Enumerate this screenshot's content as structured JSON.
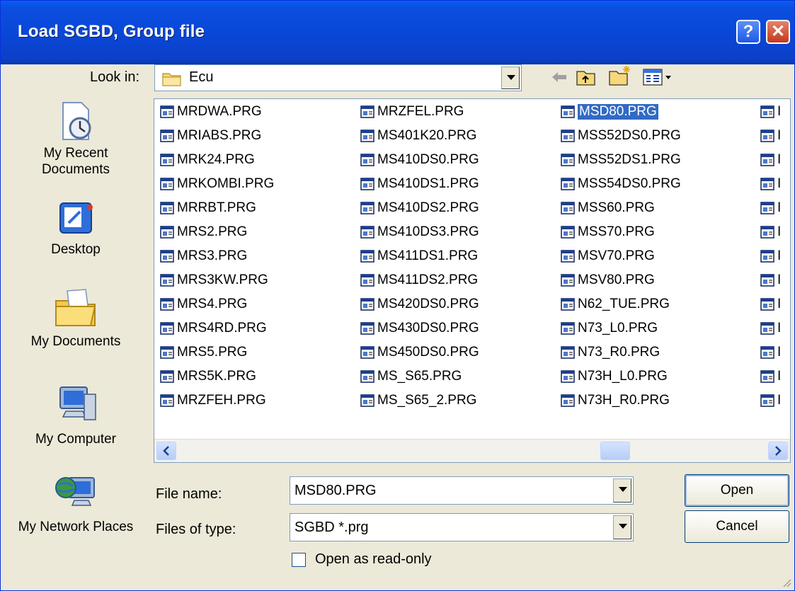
{
  "window": {
    "title": "Load SGBD, Group file",
    "help_glyph": "?",
    "close_glyph": "✕"
  },
  "lookin": {
    "label": "Look in:",
    "value": "Ecu"
  },
  "toolbar": {
    "back": "back-arrow-icon",
    "up": "up-folder-icon",
    "new_folder": "new-folder-icon",
    "view": "view-menu-icon"
  },
  "places": [
    {
      "label": "My Recent Documents",
      "icon": "recent-documents-icon"
    },
    {
      "label": "Desktop",
      "icon": "desktop-icon"
    },
    {
      "label": "My Documents",
      "icon": "my-documents-icon"
    },
    {
      "label": "My Computer",
      "icon": "my-computer-icon"
    },
    {
      "label": "My Network Places",
      "icon": "network-places-icon"
    }
  ],
  "files": {
    "col1": [
      "MRDWA.PRG",
      "MRIABS.PRG",
      "MRK24.PRG",
      "MRKOMBI.PRG",
      "MRRBT.PRG",
      "MRS2.PRG",
      "MRS3.PRG",
      "MRS3KW.PRG",
      "MRS4.PRG",
      "MRS4RD.PRG",
      "MRS5.PRG",
      "MRS5K.PRG",
      "MRZFEH.PRG"
    ],
    "col2": [
      "MRZFEL.PRG",
      "MS401K20.PRG",
      "MS410DS0.PRG",
      "MS410DS1.PRG",
      "MS410DS2.PRG",
      "MS410DS3.PRG",
      "MS411DS1.PRG",
      "MS411DS2.PRG",
      "MS420DS0.PRG",
      "MS430DS0.PRG",
      "MS450DS0.PRG",
      "MS_S65.PRG",
      "MS_S65_2.PRG"
    ],
    "col3": [
      "MSD80.PRG",
      "MSS52DS0.PRG",
      "MSS52DS1.PRG",
      "MSS54DS0.PRG",
      "MSS60.PRG",
      "MSS70.PRG",
      "MSV70.PRG",
      "MSV80.PRG",
      "N62_TUE.PRG",
      "N73_L0.PRG",
      "N73_R0.PRG",
      "N73H_L0.PRG",
      "N73H_R0.PRG"
    ],
    "col4_partial": [
      "I",
      "I",
      "I",
      "I",
      "I",
      "I",
      "I",
      "I",
      "I",
      "I",
      "I",
      "I",
      "I"
    ],
    "selected": "MSD80.PRG"
  },
  "form": {
    "filename_label": "File name:",
    "filename_value": "MSD80.PRG",
    "filetype_label": "Files of type:",
    "filetype_value": "SGBD *.prg",
    "readonly_label": "Open as read-only",
    "readonly_checked": false
  },
  "buttons": {
    "open": "Open",
    "cancel": "Cancel"
  },
  "colors": {
    "title_bar": "#0b4fe0",
    "dialog_bg": "#ece9d8",
    "selection": "#316ac5"
  }
}
